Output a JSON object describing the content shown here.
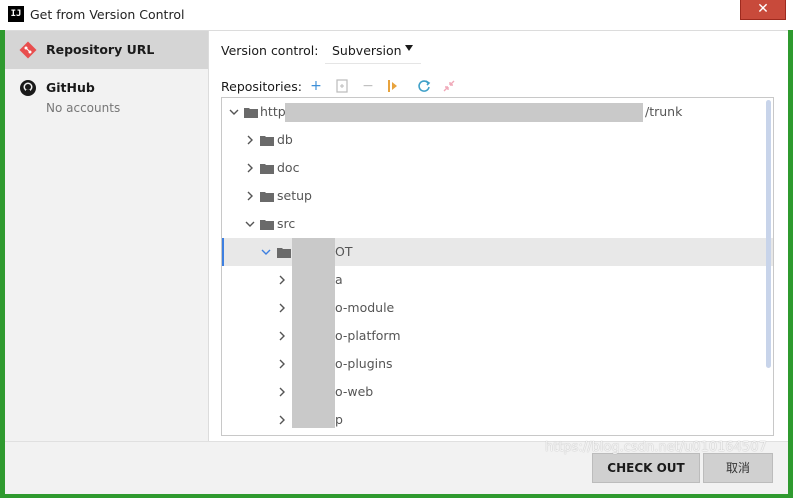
{
  "window": {
    "title": "Get from Version Control",
    "close_label": "✕"
  },
  "sidebar": {
    "items": [
      {
        "label": "Repository URL",
        "sublabel": ""
      },
      {
        "label": "GitHub",
        "sublabel": "No accounts"
      }
    ]
  },
  "main": {
    "version_control_label": "Version control:",
    "version_control_value": "Subversion",
    "repositories_label": "Repositories:"
  },
  "tree": {
    "nodes": [
      {
        "label": "https",
        "suffix": "/trunk",
        "expanded": true,
        "level": 0
      },
      {
        "label": "db",
        "expanded": false,
        "level": 1
      },
      {
        "label": "doc",
        "expanded": false,
        "level": 1
      },
      {
        "label": "setup",
        "expanded": false,
        "level": 1
      },
      {
        "label": "src",
        "expanded": true,
        "level": 1
      },
      {
        "label": "OT",
        "expanded": true,
        "level": 2,
        "selected": true
      },
      {
        "label": "a",
        "expanded": false,
        "level": 3
      },
      {
        "label": "o-module",
        "expanded": false,
        "level": 3
      },
      {
        "label": "o-platform",
        "expanded": false,
        "level": 3
      },
      {
        "label": "o-plugins",
        "expanded": false,
        "level": 3
      },
      {
        "label": "o-web",
        "expanded": false,
        "level": 3
      },
      {
        "label": "p",
        "expanded": false,
        "level": 3
      }
    ]
  },
  "footer": {
    "checkout_label": "CHECK OUT",
    "cancel_label": "取消"
  },
  "watermark": "https://blog.csdn.net/u010164507",
  "colors": {
    "accent": "#3d7fe0",
    "window_frame": "#2f9a2f",
    "close": "#c84a3b"
  }
}
